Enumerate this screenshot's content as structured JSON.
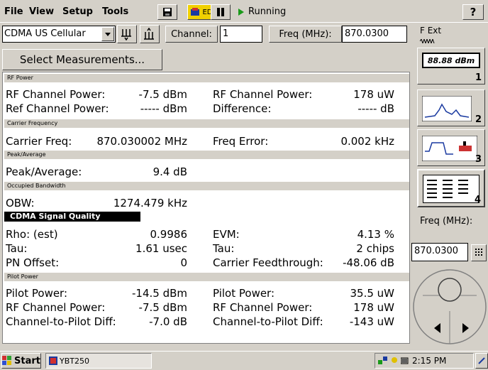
{
  "menu": {
    "file": "File",
    "view": "View",
    "setup": "Setup",
    "tools": "Tools"
  },
  "toolbar": {
    "edit_label": "EDIT",
    "status": "Running",
    "help": "?"
  },
  "standard": {
    "selected": "CDMA US Cellular"
  },
  "channel": {
    "label": "Channel:",
    "value": "1"
  },
  "freq": {
    "label": "Freq (MHz):",
    "value": "870.0300"
  },
  "select_measurements": "Select Measurements...",
  "sections": {
    "rf_power": "RF Power",
    "carrier_freq": "Carrier Frequency",
    "peak_avg": "Peak/Average",
    "obw": "Occupied Bandwidth",
    "signal_quality": "CDMA Signal Quality",
    "pilot_power": "Pilot Power"
  },
  "rf": {
    "ch_power_label": "RF Channel Power:",
    "ch_power_value": "-7.5 dBm",
    "ch_power_label2": "RF Channel Power:",
    "ch_power_value2": "178 uW",
    "ref_label": "Ref Channel Power:",
    "ref_value": "----- dBm",
    "diff_label": "Difference:",
    "diff_value": "----- dB"
  },
  "carrier": {
    "freq_label": "Carrier Freq:",
    "freq_value": "870.030002 MHz",
    "err_label": "Freq Error:",
    "err_value": "0.002 kHz"
  },
  "peak": {
    "label": "Peak/Average:",
    "value": "9.4 dB"
  },
  "obw": {
    "label": "OBW:",
    "value": "1274.479 kHz"
  },
  "quality": {
    "rho_label": "Rho: (est)",
    "rho_value": "0.9986",
    "evm_label": "EVM:",
    "evm_value": "4.13 %",
    "tau_label": "Tau:",
    "tau_value": "1.61 usec",
    "tau_label2": "Tau:",
    "tau_value2": "2 chips",
    "pn_label": "PN Offset:",
    "pn_value": "0",
    "cf_label": "Carrier Feedthrough:",
    "cf_value": "-48.06 dB"
  },
  "pilot": {
    "pp_label": "Pilot Power:",
    "pp_value": "-14.5 dBm",
    "pp_label2": "Pilot Power:",
    "pp_value2": "35.5 uW",
    "rf_label": "RF Channel Power:",
    "rf_value": "-7.5 dBm",
    "rf_label2": "RF Channel Power:",
    "rf_value2": "178 uW",
    "ctp_label": "Channel-to-Pilot Diff:",
    "ctp_value": "-7.0 dB",
    "ctp_label2": "Channel-to-Pilot Diff:",
    "ctp_value2": "-143 uW"
  },
  "sidebar": {
    "fext": "F Ext",
    "btn1_text": "88.88 dBm",
    "btn1_num": "1",
    "btn2_num": "2",
    "btn3_num": "3",
    "btn4_num": "4",
    "freq_label": "Freq (MHz):",
    "freq_value": "870.0300"
  },
  "taskbar": {
    "start": "Start",
    "app": "YBT250",
    "time": "2:15 PM"
  },
  "colors": {
    "accent_yellow": "#f0d000",
    "nav_blue": "#0a246a",
    "running_green": "#1a9a1a"
  }
}
